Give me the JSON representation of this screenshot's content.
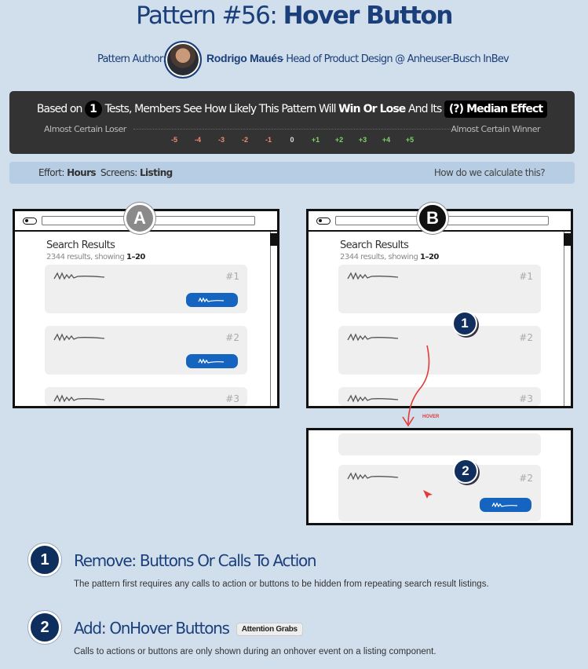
{
  "header": {
    "title_prefix": "Pattern #56:",
    "title_name": "Hover Button"
  },
  "author": {
    "label": "Pattern Author:",
    "name": "Rodrigo Maués",
    "role": "- Head of Product Design @ Anheuser-Busch InBev"
  },
  "results": {
    "prefix": "Based on",
    "test_count": "1",
    "middle": "Tests, Members See How Likely This Pattern Will",
    "strong": "Win Or Lose",
    "suffix": "And Its",
    "median_label": "(?) Median Effect",
    "loser_label": "Almost Certain Loser",
    "winner_label": "Almost Certain Winner",
    "scale": [
      {
        "label": "-5",
        "color": "#f08a70"
      },
      {
        "label": "-4",
        "color": "#f08a70"
      },
      {
        "label": "-3",
        "color": "#f08a70"
      },
      {
        "label": "-2",
        "color": "#f08a70"
      },
      {
        "label": "-1",
        "color": "#f08a70"
      },
      {
        "label": "0",
        "color": "#dddddd"
      },
      {
        "label": "+1",
        "color": "#7dd36b"
      },
      {
        "label": "+2",
        "color": "#7dd36b"
      },
      {
        "label": "+3",
        "color": "#7dd36b"
      },
      {
        "label": "+4",
        "color": "#7dd36b"
      },
      {
        "label": "+5",
        "color": "#7dd36b"
      }
    ]
  },
  "info": {
    "effort_label": "Effort:",
    "effort_value": "Hours",
    "screens_label": "Screens:",
    "screens_value": "Listing",
    "calc_link": "How do we calculate this?"
  },
  "variant_a": {
    "badge": "A",
    "badge_color": "#8a8a8a",
    "results_title": "Search Results",
    "results_count": "2344 results, showing",
    "results_range": "1–20",
    "cards": [
      "#1",
      "#2",
      "#3"
    ]
  },
  "variant_b": {
    "badge": "B",
    "badge_color": "#111111",
    "results_title": "Search Results",
    "results_count": "2344 results, showing",
    "results_range": "1–20",
    "cards": [
      "#1",
      "#2",
      "#3"
    ],
    "pin_1": "1",
    "hover_label": "HOVER",
    "hover_card": "#2",
    "pin_2": "2"
  },
  "steps": [
    {
      "number": "1",
      "title": "Remove: Buttons Or Calls To Action",
      "tag": "",
      "description": "The pattern first requires any calls to action or buttons to be hidden from repeating search result listings."
    },
    {
      "number": "2",
      "title": "Add: OnHover Buttons",
      "tag": "Attention Grabs",
      "description": "Calls to actions or buttons are only shown during an onhover event on a listing component."
    }
  ]
}
